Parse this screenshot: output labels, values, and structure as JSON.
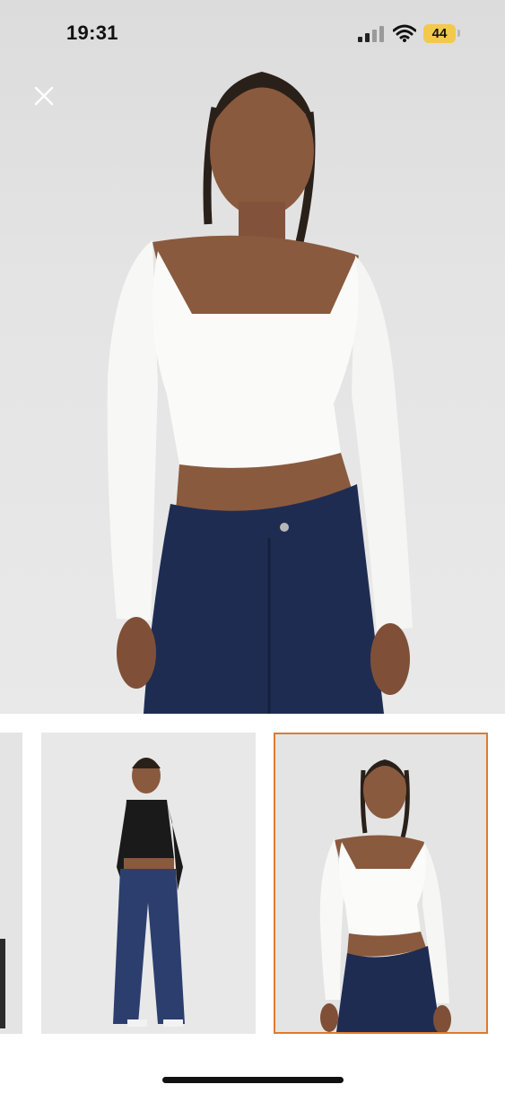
{
  "status_bar": {
    "time": "19:31",
    "battery_level": "44",
    "icons": [
      "signal-icon",
      "wifi-icon",
      "battery-icon"
    ]
  },
  "product_view": {
    "close_icon": "close-icon",
    "accent_color": "#e07a2b",
    "selected_thumbnail_index": 2,
    "thumbnails": [
      {
        "name": "thumbnail-partial"
      },
      {
        "name": "thumbnail-black-top"
      },
      {
        "name": "thumbnail-white-top"
      }
    ]
  }
}
